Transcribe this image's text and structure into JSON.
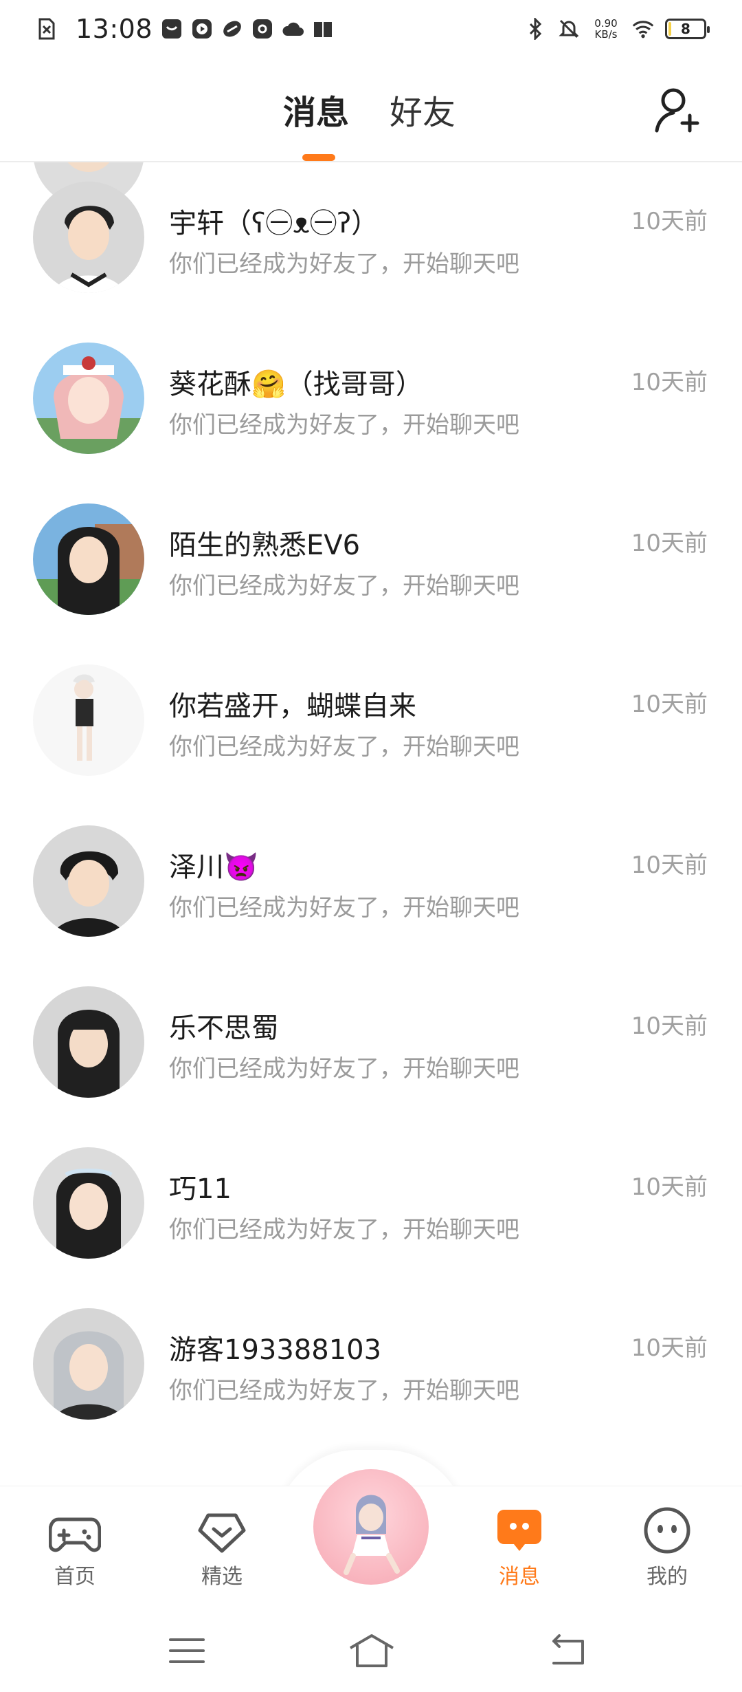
{
  "status_bar": {
    "time": "13:08",
    "net_speed_value": "0.90",
    "net_speed_unit": "KB/s",
    "battery": "8",
    "battery_level": 0.08
  },
  "header": {
    "tabs": [
      {
        "label": "消息",
        "active": true
      },
      {
        "label": "好友",
        "active": false
      }
    ]
  },
  "accent_color": "#ff7a1a",
  "messages": [
    {
      "name": "宇轩（ʕ㊀ᴥ㊀ʔ）",
      "preview": "你们已经成为好友了，开始聊天吧",
      "time": "10天前"
    },
    {
      "name": "葵花酥🤗（找哥哥）",
      "preview": "你们已经成为好友了，开始聊天吧",
      "time": "10天前"
    },
    {
      "name": "陌生的熟悉EV6",
      "preview": "你们已经成为好友了，开始聊天吧",
      "time": "10天前"
    },
    {
      "name": "你若盛开，蝴蝶自来",
      "preview": "你们已经成为好友了，开始聊天吧",
      "time": "10天前"
    },
    {
      "name": "泽川👿",
      "preview": "你们已经成为好友了，开始聊天吧",
      "time": "10天前"
    },
    {
      "name": "乐不思蜀",
      "preview": "你们已经成为好友了，开始聊天吧",
      "time": "10天前"
    },
    {
      "name": "巧11",
      "preview": "你们已经成为好友了，开始聊天吧",
      "time": "10天前"
    },
    {
      "name": "游客193388103",
      "preview": "你们已经成为好友了，开始聊天吧",
      "time": "10天前"
    }
  ],
  "bottom_nav": [
    {
      "label": "首页",
      "icon": "gamepad-icon",
      "active": false
    },
    {
      "label": "精选",
      "icon": "heart-badge-icon",
      "active": false
    },
    {
      "label": "消息",
      "icon": "chat-bubble-icon",
      "active": true
    },
    {
      "label": "我的",
      "icon": "face-icon",
      "active": false
    }
  ]
}
